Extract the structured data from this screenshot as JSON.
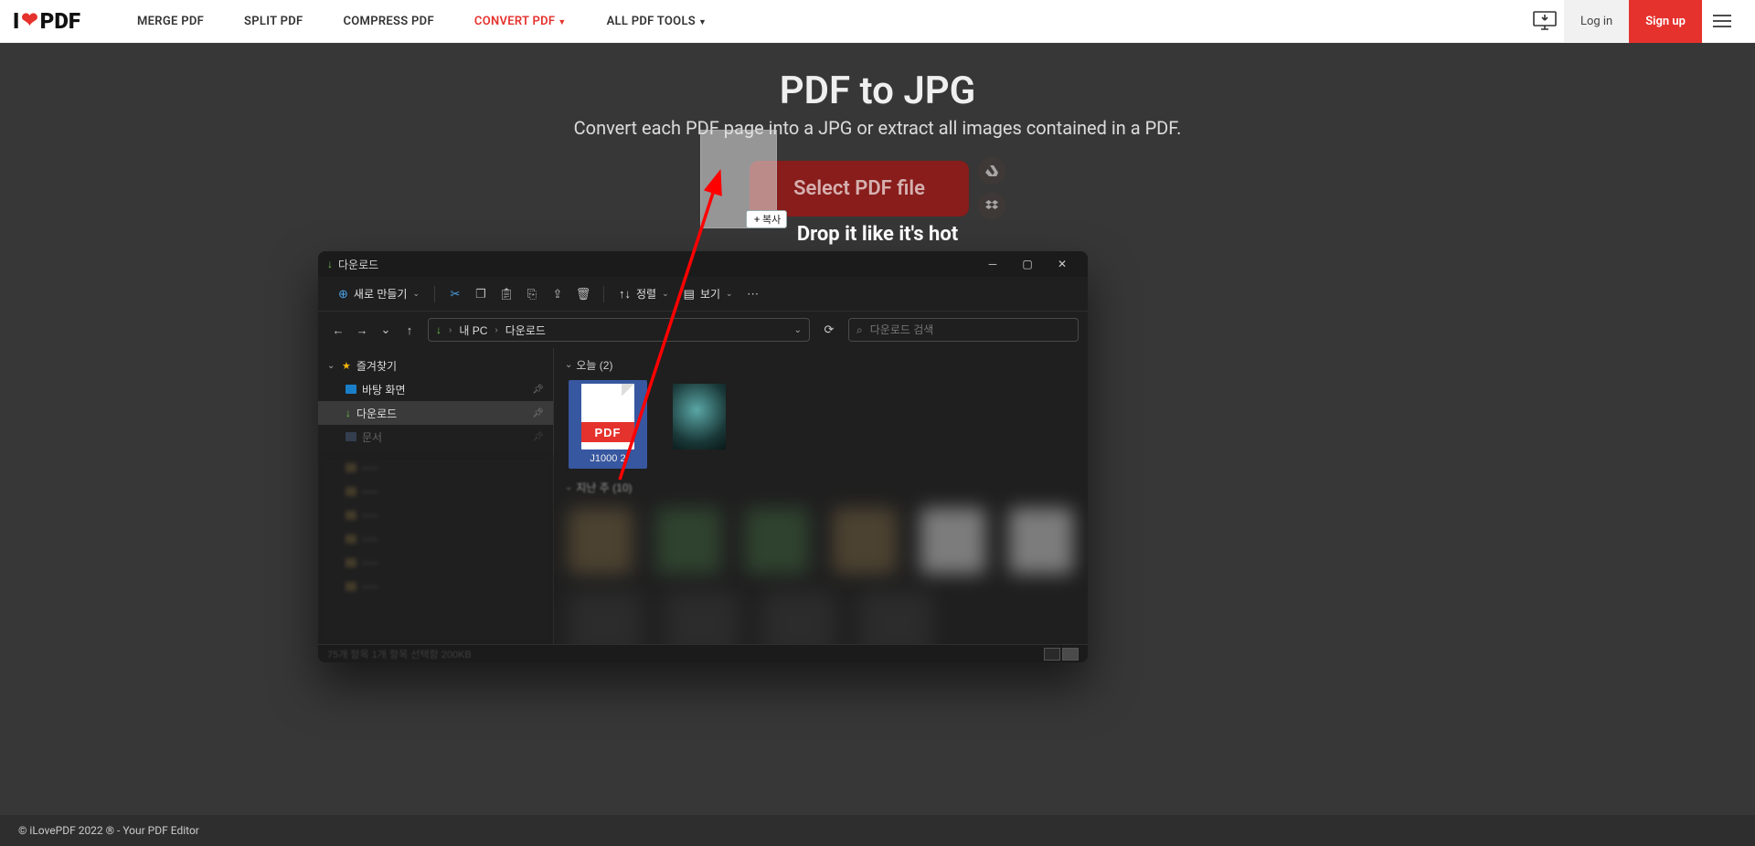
{
  "nav": {
    "logo_left": "I",
    "logo_right": "PDF",
    "items": [
      {
        "label": "MERGE PDF",
        "active": false,
        "caret": false
      },
      {
        "label": "SPLIT PDF",
        "active": false,
        "caret": false
      },
      {
        "label": "COMPRESS PDF",
        "active": false,
        "caret": false
      },
      {
        "label": "CONVERT PDF",
        "active": true,
        "caret": true
      },
      {
        "label": "ALL PDF TOOLS",
        "active": false,
        "caret": true
      }
    ],
    "login": "Log in",
    "signup": "Sign up"
  },
  "hero": {
    "title": "PDF to JPG",
    "subtitle": "Convert each PDF page into a JPG or extract all images contained in a PDF.",
    "select_btn": "Select PDF file",
    "drop_text": "Drop it like it's hot"
  },
  "drag": {
    "label": "+ 복사"
  },
  "footer": "© iLovePDF 2022 ® - Your PDF Editor",
  "explorer": {
    "title": "다운로드",
    "cmd_new": "새로 만들기",
    "cmd_sort": "정렬",
    "cmd_view": "보기",
    "breadcrumb": [
      "내 PC",
      "다운로드"
    ],
    "search_placeholder": "다운로드 검색",
    "sidebar": {
      "favorites": "즐겨찾기",
      "desktop": "바탕 화면",
      "downloads": "다운로드",
      "documents": "문서"
    },
    "groups": {
      "today": "오늘 (2)",
      "lastweek": "지난 주 (10)"
    },
    "files": {
      "pdf_band": "PDF",
      "pdf_name": "J1000\n2"
    },
    "status_text": "75개 항목   1개 항목 선택함 200KB"
  }
}
